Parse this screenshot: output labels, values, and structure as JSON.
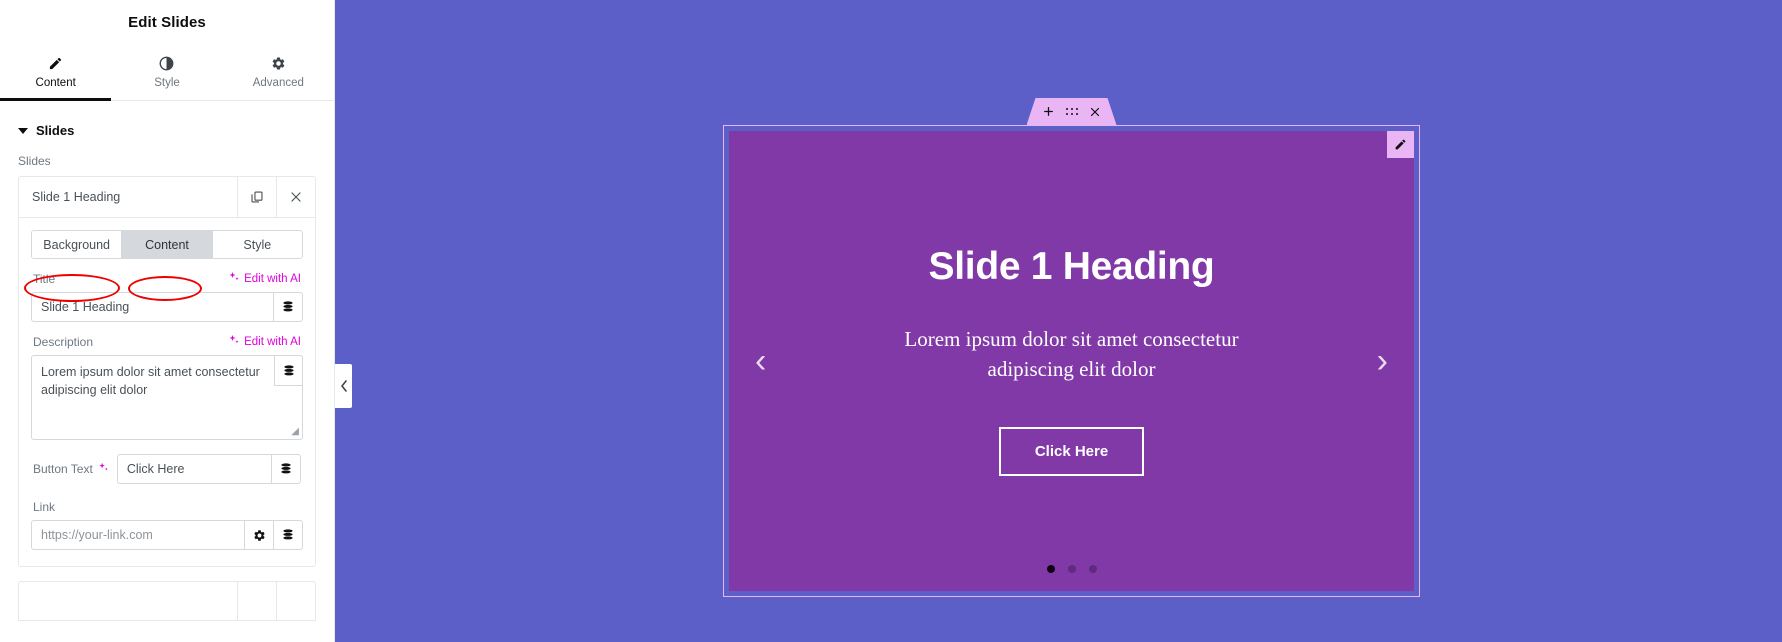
{
  "panel": {
    "title": "Edit Slides",
    "tabs": [
      {
        "label": "Content",
        "icon": "pencil-icon",
        "active": true
      },
      {
        "label": "Style",
        "icon": "contrast-icon",
        "active": false
      },
      {
        "label": "Advanced",
        "icon": "gear-icon",
        "active": false
      }
    ],
    "section": {
      "title": "Slides"
    },
    "slides_control_label": "Slides",
    "repeater": {
      "item_title": "Slide 1 Heading",
      "duplicate_icon": "duplicate-icon",
      "remove_icon": "close-icon",
      "subtabs": [
        {
          "label": "Background",
          "active": false
        },
        {
          "label": "Content",
          "active": true
        },
        {
          "label": "Style",
          "active": false
        }
      ],
      "fields": {
        "title_label": "Title",
        "title_value": "Slide 1 Heading",
        "description_label": "Description",
        "description_value": "Lorem ipsum dolor sit amet consectetur adipiscing elit dolor",
        "button_text_label": "Button Text",
        "button_text_value": "Click Here",
        "link_label": "Link",
        "link_placeholder": "https://your-link.com",
        "link_value": "",
        "ai_link_label": "Edit with AI"
      }
    },
    "collapse_icon": "chevron-left-icon"
  },
  "canvas": {
    "widget_handle": {
      "add_label": "+",
      "drag_label": "drag-handle",
      "close_label": "×"
    },
    "slide": {
      "heading": "Slide 1 Heading",
      "description": "Lorem ipsum dolor sit amet consectetur adipiscing elit dolor",
      "button_label": "Click Here",
      "prev_arrow": "‹",
      "next_arrow": "›",
      "dots": [
        {
          "active": true
        },
        {
          "active": false
        },
        {
          "active": false
        }
      ],
      "edit_icon": "pencil-icon"
    }
  },
  "colors": {
    "canvas_background": "#5b5fc7",
    "slide_background": "#8139a8",
    "handle": "#eab5f5",
    "accent_ai": "#e000e0",
    "annotation": "#ee0000"
  }
}
